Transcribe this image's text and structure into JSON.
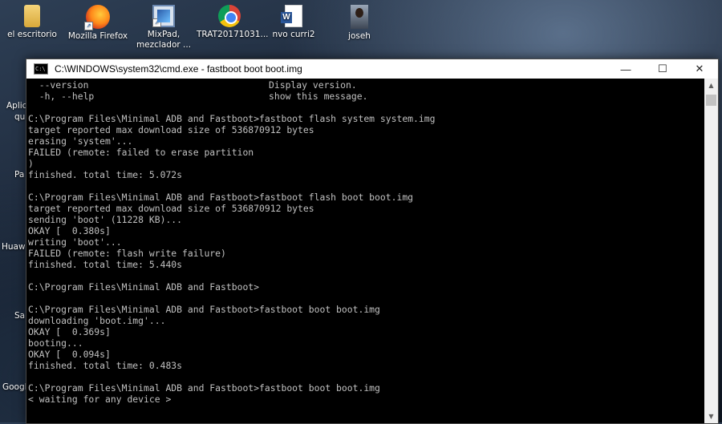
{
  "desktop": {
    "icons": [
      {
        "label": "el escritorio",
        "icon": "folder-icon"
      },
      {
        "label": "Mozilla Firefox",
        "icon": "firefox-icon"
      },
      {
        "label": "MixPad, mezclador ...",
        "icon": "mixpad-icon"
      },
      {
        "label": "TRAT20171031...",
        "icon": "chrome-icon"
      },
      {
        "label": "nvo curri2",
        "icon": "word-document-icon"
      },
      {
        "label": "joseh",
        "icon": "photo-icon"
      }
    ],
    "edge_labels": [
      "Aplic",
      "qu",
      "Pa",
      "Huaw",
      "Sa",
      "Googl"
    ]
  },
  "window": {
    "title": "C:\\WINDOWS\\system32\\cmd.exe - fastboot  boot boot.img",
    "minimize": "—",
    "maximize": "☐",
    "close": "✕",
    "scroll_up": "▲",
    "scroll_down": "▼"
  },
  "console": {
    "lines": [
      {
        "a": "  --version",
        "b": "Display version."
      },
      {
        "a": "  -h, --help",
        "b": "show this message."
      },
      {
        "a": ""
      },
      {
        "a": "C:\\Program Files\\Minimal ADB and Fastboot>fastboot flash system system.img"
      },
      {
        "a": "target reported max download size of 536870912 bytes"
      },
      {
        "a": "erasing 'system'..."
      },
      {
        "a": "FAILED (remote: failed to erase partition"
      },
      {
        "a": ")"
      },
      {
        "a": "finished. total time: 5.072s"
      },
      {
        "a": ""
      },
      {
        "a": "C:\\Program Files\\Minimal ADB and Fastboot>fastboot flash boot boot.img"
      },
      {
        "a": "target reported max download size of 536870912 bytes"
      },
      {
        "a": "sending 'boot' (11228 KB)..."
      },
      {
        "a": "OKAY [  0.380s]"
      },
      {
        "a": "writing 'boot'..."
      },
      {
        "a": "FAILED (remote: flash write failure)"
      },
      {
        "a": "finished. total time: 5.440s"
      },
      {
        "a": ""
      },
      {
        "a": "C:\\Program Files\\Minimal ADB and Fastboot>"
      },
      {
        "a": ""
      },
      {
        "a": "C:\\Program Files\\Minimal ADB and Fastboot>fastboot boot boot.img"
      },
      {
        "a": "downloading 'boot.img'..."
      },
      {
        "a": "OKAY [  0.369s]"
      },
      {
        "a": "booting..."
      },
      {
        "a": "OKAY [  0.094s]"
      },
      {
        "a": "finished. total time: 0.483s"
      },
      {
        "a": ""
      },
      {
        "a": "C:\\Program Files\\Minimal ADB and Fastboot>fastboot boot boot.img"
      },
      {
        "a": "< waiting for any device >"
      }
    ]
  }
}
